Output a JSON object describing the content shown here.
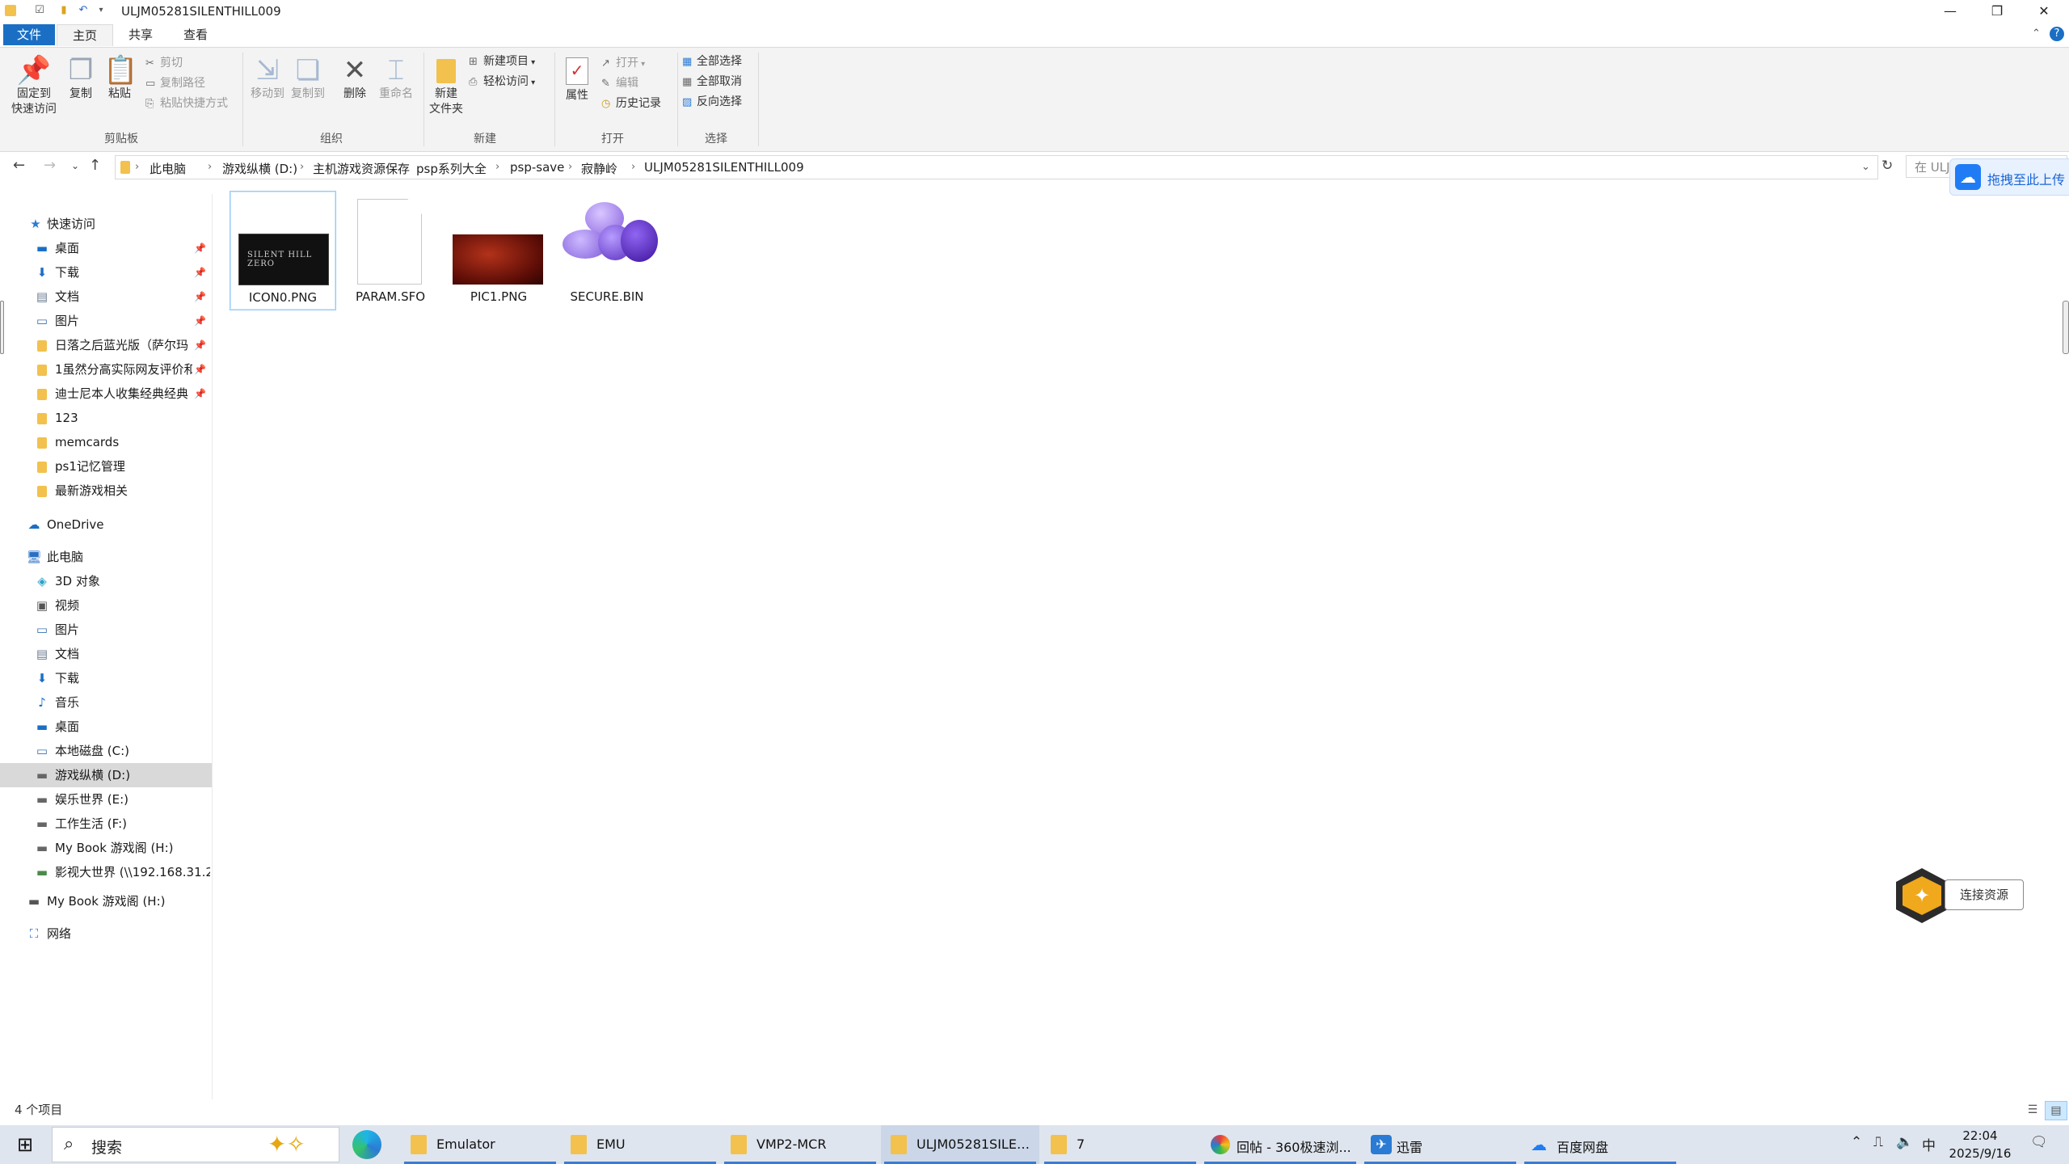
{
  "window": {
    "title": "ULJM05281SILENTHILL009",
    "controls": {
      "minimize": "—",
      "maximize": "❐",
      "close": "✕"
    }
  },
  "ribbon": {
    "tabs": [
      "文件",
      "主页",
      "共享",
      "查看"
    ],
    "clipboard": {
      "group_label": "剪贴板",
      "pin_label_1": "固定到",
      "pin_label_2": "快速访问",
      "copy": "复制",
      "paste": "粘贴",
      "cut": "剪切",
      "copy_path": "复制路径",
      "paste_shortcut": "粘贴快捷方式"
    },
    "organize": {
      "group_label": "组织",
      "move_to": "移动到",
      "copy_to": "复制到",
      "delete": "删除",
      "rename": "重命名"
    },
    "new": {
      "group_label": "新建",
      "new_folder_1": "新建",
      "new_folder_2": "文件夹",
      "new_item": "新建项目",
      "easy_access": "轻松访问"
    },
    "open": {
      "group_label": "打开",
      "properties": "属性",
      "open": "打开",
      "edit": "编辑",
      "history": "历史记录"
    },
    "select": {
      "group_label": "选择",
      "select_all": "全部选择",
      "select_none": "全部取消",
      "invert": "反向选择"
    }
  },
  "address": {
    "crumbs": [
      "此电脑",
      "游戏纵横 (D:)",
      "主机游戏资源保存",
      "psp系列大全",
      "psp-save",
      "寂静岭",
      "ULJM05281SILENTHILL009"
    ],
    "search_placeholder": "在 ULJ"
  },
  "baidu_float": {
    "label": "拖拽至此上传"
  },
  "nav": {
    "quick_access": "快速访问",
    "quick_items": [
      {
        "label": "桌面",
        "pinned": true
      },
      {
        "label": "下载",
        "pinned": true
      },
      {
        "label": "文档",
        "pinned": true
      },
      {
        "label": "图片",
        "pinned": true
      },
      {
        "label": "日落之后蓝光版（萨尔玛",
        "pinned": true
      },
      {
        "label": "1虽然分高实际网友评价和",
        "pinned": true
      },
      {
        "label": "迪士尼本人收集经典经典",
        "pinned": true
      },
      {
        "label": "123",
        "pinned": false
      },
      {
        "label": "memcards",
        "pinned": false
      },
      {
        "label": "ps1记忆管理",
        "pinned": false
      },
      {
        "label": "最新游戏相关",
        "pinned": false
      }
    ],
    "onedrive": "OneDrive",
    "this_pc": "此电脑",
    "pc_items": [
      "3D 对象",
      "视频",
      "图片",
      "文档",
      "下载",
      "音乐",
      "桌面",
      "本地磁盘 (C:)",
      "游戏纵横 (D:)",
      "娱乐世界 (E:)",
      "工作生活 (F:)",
      "My Book 游戏阁 (H:)",
      "影视大世界 (\\\\192.168.31.2"
    ],
    "mybook": "My Book 游戏阁 (H:)",
    "network": "网络"
  },
  "files": [
    {
      "name": "ICON0.PNG",
      "thumb_text": "SILENT HILL ZERO"
    },
    {
      "name": "PARAM.SFO"
    },
    {
      "name": "PIC1.PNG"
    },
    {
      "name": "SECURE.BIN"
    }
  ],
  "status": {
    "count": "4 个项目"
  },
  "connect": {
    "label": "连接资源"
  },
  "taskbar": {
    "search": "搜索",
    "items": [
      "Emulator",
      "EMU",
      "VMP2-MCR",
      "ULJM05281SILEN...",
      "7",
      "回帖 - 360极速浏...",
      "迅雷",
      "百度网盘"
    ],
    "ime": "中",
    "time": "22:04",
    "date": "2025/9/16"
  }
}
